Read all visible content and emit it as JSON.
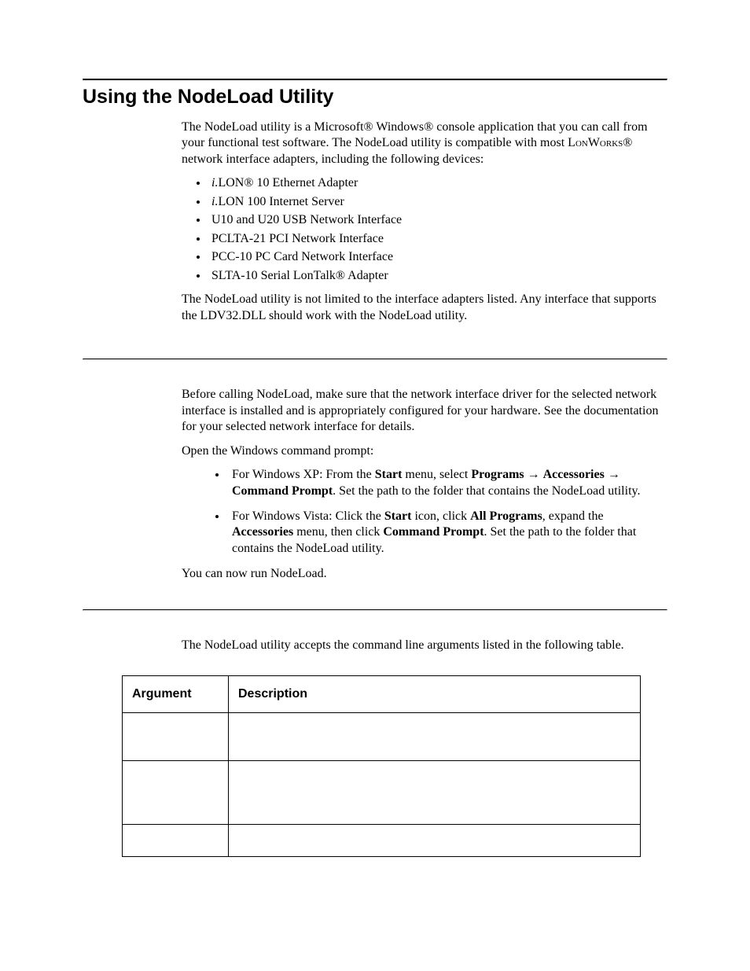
{
  "heading": "Using the NodeLoad Utility",
  "intro": "The NodeLoad utility is a Microsoft® Windows® console application that you can call from your functional test software.  The NodeLoad utility is compatible with most ",
  "intro_lonworks": "LonWorks",
  "intro_tail": "® network interface adapters, including the following devices:",
  "devices": {
    "d0_pre": "i.",
    "d0_mid": "LON",
    "d0_post": "® 10 Ethernet Adapter",
    "d1_pre": "i.",
    "d1_mid": "LON 100 Internet Server",
    "d2": "U10 and U20 USB Network Interface",
    "d3": "PCLTA-21 PCI Network Interface",
    "d4": "PCC-10 PC Card Network Interface",
    "d5": "SLTA-10 Serial LonTalk® Adapter"
  },
  "limit": "The NodeLoad utility is not limited to the interface adapters listed.  Any interface that supports the LDV32.DLL should work with the NodeLoad utility.",
  "before": "Before calling NodeLoad, make sure that the network interface driver for the selected network interface is installed and is appropriately configured for your hardware.  See the documentation for your selected network interface for details.",
  "open_prompt": "Open the Windows command prompt:",
  "xp": {
    "pre": "For Windows XP:  From the ",
    "start": "Start",
    "mid1": " menu, select ",
    "programs": "Programs",
    "arrow1": " → ",
    "accessories": "Accessories",
    "arrow2": " → ",
    "cmd": "Command Prompt",
    "post": ".  Set the path to the folder that contains the NodeLoad utility."
  },
  "vista": {
    "pre": "For Windows Vista:  Click the ",
    "start": "Start",
    "mid1": " icon, click ",
    "allprog": "All Programs",
    "mid2": ", expand the ",
    "accessories": "Accessories",
    "mid3": " menu, then click ",
    "cmd": "Command Prompt",
    "post": ".  Set the path to the folder that contains the NodeLoad utility."
  },
  "now_run": "You can now run NodeLoad.",
  "args_intro": "The NodeLoad utility accepts the command line arguments listed in the following table.",
  "table": {
    "h_arg": "Argument",
    "h_desc": "Description"
  }
}
